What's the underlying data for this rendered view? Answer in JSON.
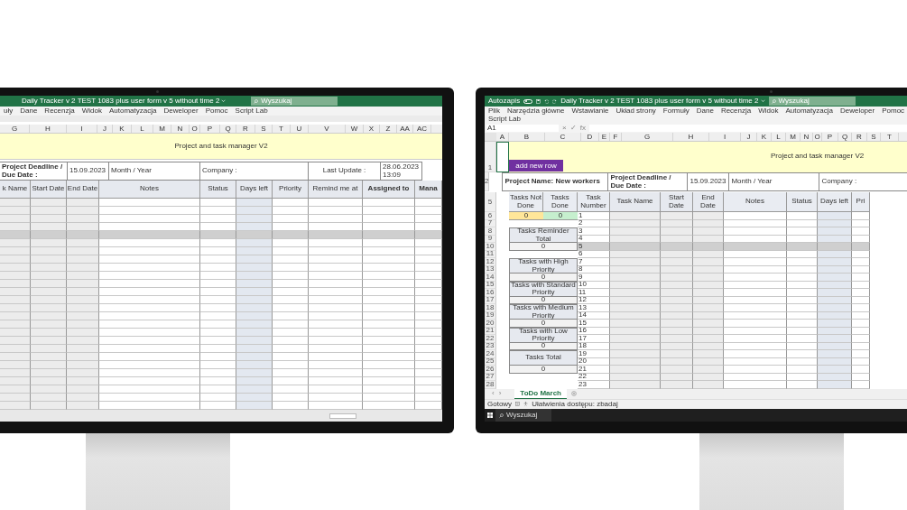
{
  "left_monitor": {
    "window": {
      "title": "Daily Tracker v 2 TEST 1083 plus user form v 5 without time 2",
      "search": {
        "placeholder": "Wyszukaj"
      }
    },
    "menu": [
      "uły",
      "Dane",
      "Recenzja",
      "Widok",
      "Automatyzacja",
      "Deweloper",
      "Pomoc",
      "Script Lab"
    ],
    "column_letters": [
      "G",
      "H",
      "I",
      "J",
      "K",
      "L",
      "M",
      "N",
      "O",
      "P",
      "Q",
      "R",
      "S",
      "T",
      "U",
      "V",
      "W",
      "X",
      "Z",
      "AA",
      "AC"
    ],
    "banner": "Project and task manager V2",
    "info_row": [
      {
        "text": "Project Deadline / Due Date :",
        "bold": true
      },
      {
        "text": "15.09.2023",
        "bold": false
      },
      {
        "text": "Month / Year",
        "bold": false
      },
      {
        "text": "Company :",
        "bold": false
      },
      {
        "text": "Last Update :",
        "bold": false
      },
      {
        "text": "28.06.2023 13:09",
        "bold": false
      }
    ],
    "columns": [
      {
        "label": "k Name",
        "kind": "gray",
        "bold": false
      },
      {
        "label": "Start Date",
        "kind": "gray",
        "bold": false
      },
      {
        "label": "End Date",
        "kind": "gray",
        "bold": false
      },
      {
        "label": "Notes",
        "kind": "plain",
        "bold": false
      },
      {
        "label": "Status",
        "kind": "plain",
        "bold": false
      },
      {
        "label": "Days left",
        "kind": "blue",
        "bold": false
      },
      {
        "label": "Priority",
        "kind": "plain",
        "bold": false
      },
      {
        "label": "Remind me at",
        "kind": "plain",
        "bold": false
      },
      {
        "label": "Assigned to",
        "kind": "plain",
        "bold": true
      },
      {
        "label": "Mana",
        "kind": "plain",
        "bold": true
      }
    ],
    "rows": [
      {
        "shaded": false
      },
      {
        "shaded": false
      },
      {
        "shaded": false
      },
      {
        "shaded": false
      },
      {
        "shaded": true
      },
      {
        "shaded": false
      },
      {
        "shaded": false
      },
      {
        "shaded": false
      },
      {
        "shaded": false
      },
      {
        "shaded": false
      },
      {
        "shaded": false
      },
      {
        "shaded": false
      },
      {
        "shaded": false
      },
      {
        "shaded": false
      },
      {
        "shaded": false
      },
      {
        "shaded": false
      },
      {
        "shaded": false
      },
      {
        "shaded": false
      },
      {
        "shaded": false
      },
      {
        "shaded": false
      },
      {
        "shaded": false
      },
      {
        "shaded": false
      },
      {
        "shaded": false
      },
      {
        "shaded": false
      },
      {
        "shaded": false
      },
      {
        "shaded": false
      }
    ]
  },
  "right_monitor": {
    "window": {
      "autosave_label": "Autozapis",
      "autosave_on": false,
      "title": "Daily Tracker v 2 TEST 1083 plus user form v 5 without time 2",
      "search": {
        "placeholder": "Wyszukaj"
      }
    },
    "menu": [
      "Plik",
      "Narzędzia główne",
      "Wstawianie",
      "Układ strony",
      "Formuły",
      "Dane",
      "Recenzja",
      "Widok",
      "Automatyzacja",
      "Deweloper",
      "Pomoc",
      "Script Lab"
    ],
    "name_box": "A1",
    "formula_buttons": [
      "×",
      "✓",
      "fx"
    ],
    "column_letters": [
      "A",
      "B",
      "C",
      "D",
      "E",
      "F",
      "G",
      "H",
      "I",
      "J",
      "K",
      "L",
      "M",
      "N",
      "O",
      "P",
      "Q",
      "R",
      "S",
      "T"
    ],
    "banner": {
      "row": "1",
      "title": "Project and task manager V2",
      "add_button": "add new row"
    },
    "project_row": {
      "row": "2",
      "cells": [
        {
          "text": "Project Name:  New workers",
          "bold": true
        },
        {
          "text": "Project Deadline / Due Date :",
          "bold": true
        },
        {
          "text": "15.09.2023",
          "bold": false
        },
        {
          "text": "Month / Year",
          "bold": false
        },
        {
          "text": "Company :",
          "bold": false
        }
      ]
    },
    "header_row": "5",
    "columns": [
      {
        "label": "Tasks Not Done",
        "kind": "blue"
      },
      {
        "label": "Tasks Done",
        "kind": "blue"
      },
      {
        "label": "Task Number",
        "kind": "plain"
      },
      {
        "label": "Task Name",
        "kind": "gray"
      },
      {
        "label": "Start Date",
        "kind": "gray"
      },
      {
        "label": "End Date",
        "kind": "gray"
      },
      {
        "label": "Notes",
        "kind": "plain"
      },
      {
        "label": "Status",
        "kind": "plain"
      },
      {
        "label": "Days left",
        "kind": "blue"
      },
      {
        "label": "Pri",
        "kind": "plain"
      }
    ],
    "rows": [
      {
        "row": "6",
        "task": "1",
        "shaded": false
      },
      {
        "row": "7",
        "task": "2",
        "shaded": false
      },
      {
        "row": "8",
        "task": "3",
        "shaded": false
      },
      {
        "row": "9",
        "task": "4",
        "shaded": false
      },
      {
        "row": "10",
        "task": "5",
        "shaded": true
      },
      {
        "row": "11",
        "task": "6",
        "shaded": false
      },
      {
        "row": "12",
        "task": "7",
        "shaded": false
      },
      {
        "row": "13",
        "task": "8",
        "shaded": false
      },
      {
        "row": "14",
        "task": "9",
        "shaded": false
      },
      {
        "row": "15",
        "task": "10",
        "shaded": false
      },
      {
        "row": "16",
        "task": "11",
        "shaded": false
      },
      {
        "row": "17",
        "task": "12",
        "shaded": false
      },
      {
        "row": "18",
        "task": "13",
        "shaded": false
      },
      {
        "row": "19",
        "task": "14",
        "shaded": false
      },
      {
        "row": "20",
        "task": "15",
        "shaded": false
      },
      {
        "row": "21",
        "task": "16",
        "shaded": false
      },
      {
        "row": "22",
        "task": "17",
        "shaded": false
      },
      {
        "row": "23",
        "task": "18",
        "shaded": false
      },
      {
        "row": "24",
        "task": "19",
        "shaded": false
      },
      {
        "row": "25",
        "task": "20",
        "shaded": false
      },
      {
        "row": "26",
        "task": "21",
        "shaded": false
      },
      {
        "row": "27",
        "task": "22",
        "shaded": false
      },
      {
        "row": "28",
        "task": "23",
        "shaded": false
      }
    ],
    "summary": [
      {
        "kind": "counters",
        "cells": [
          {
            "text": "0",
            "color": "#ffe699"
          },
          {
            "text": "0",
            "color": "#c6efce"
          }
        ]
      },
      {
        "kind": "blank"
      },
      {
        "kind": "label",
        "text": "Tasks Reminder Total"
      },
      {
        "kind": "value",
        "text": "0"
      },
      {
        "kind": "blank"
      },
      {
        "kind": "label",
        "text": "Tasks with High Priority"
      },
      {
        "kind": "value",
        "text": "0"
      },
      {
        "kind": "label",
        "text": "Tasks with Standard Priority"
      },
      {
        "kind": "value",
        "text": "0"
      },
      {
        "kind": "label",
        "text": "Tasks with Medium Priority"
      },
      {
        "kind": "value",
        "text": "0"
      },
      {
        "kind": "label",
        "text": "Tasks with Low Priority"
      },
      {
        "kind": "value",
        "text": "0"
      },
      {
        "kind": "label",
        "text": "Tasks Total"
      },
      {
        "kind": "value",
        "text": "0"
      }
    ],
    "sheet_tabs": [
      {
        "label": "ToDo March",
        "selected": true
      }
    ],
    "sheet_nav": [
      "‹",
      "›"
    ],
    "status_bar": {
      "ready": "Gotowy",
      "accessibility": "Ułatwienia dostępu: zbadaj"
    },
    "taskbar": {
      "search": "Wyszukaj"
    }
  }
}
